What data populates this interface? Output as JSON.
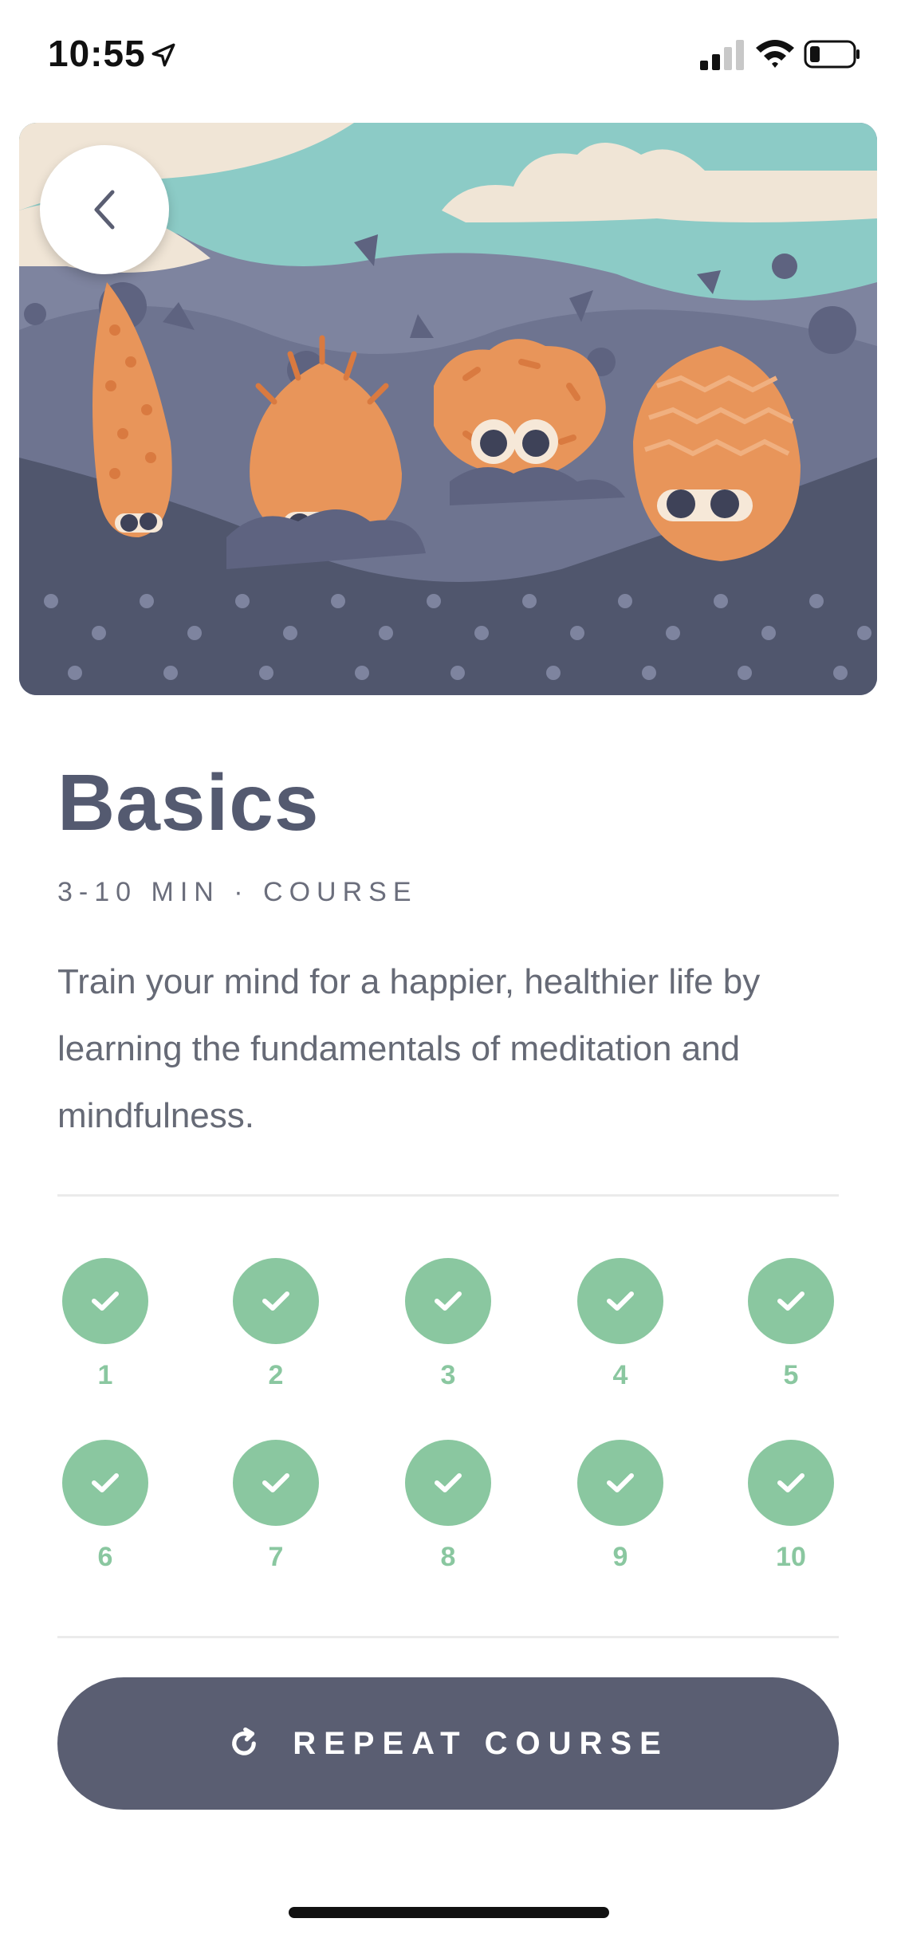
{
  "status_bar": {
    "time": "10:55",
    "icons": [
      "location-arrow-icon",
      "cellular-signal-icon",
      "wifi-icon",
      "battery-icon"
    ]
  },
  "hero": {
    "illustration": "four orange creatures peeking from purple hills under a teal sky",
    "back_icon": "chevron-left-icon"
  },
  "course": {
    "title": "Basics",
    "meta": "3-10 MIN · COURSE",
    "description": "Train your mind for a happier, healthier life by learning the fundamentals of meditation and mindfulness."
  },
  "sessions": [
    {
      "number": "1",
      "completed": true
    },
    {
      "number": "2",
      "completed": true
    },
    {
      "number": "3",
      "completed": true
    },
    {
      "number": "4",
      "completed": true
    },
    {
      "number": "5",
      "completed": true
    },
    {
      "number": "6",
      "completed": true
    },
    {
      "number": "7",
      "completed": true
    },
    {
      "number": "8",
      "completed": true
    },
    {
      "number": "9",
      "completed": true
    },
    {
      "number": "10",
      "completed": true
    }
  ],
  "cta": {
    "label": "REPEAT COURSE",
    "icon": "repeat-icon"
  },
  "colors": {
    "accent_green": "#8ac7a0",
    "button_bg": "#5a5e72",
    "title": "#545a70"
  }
}
